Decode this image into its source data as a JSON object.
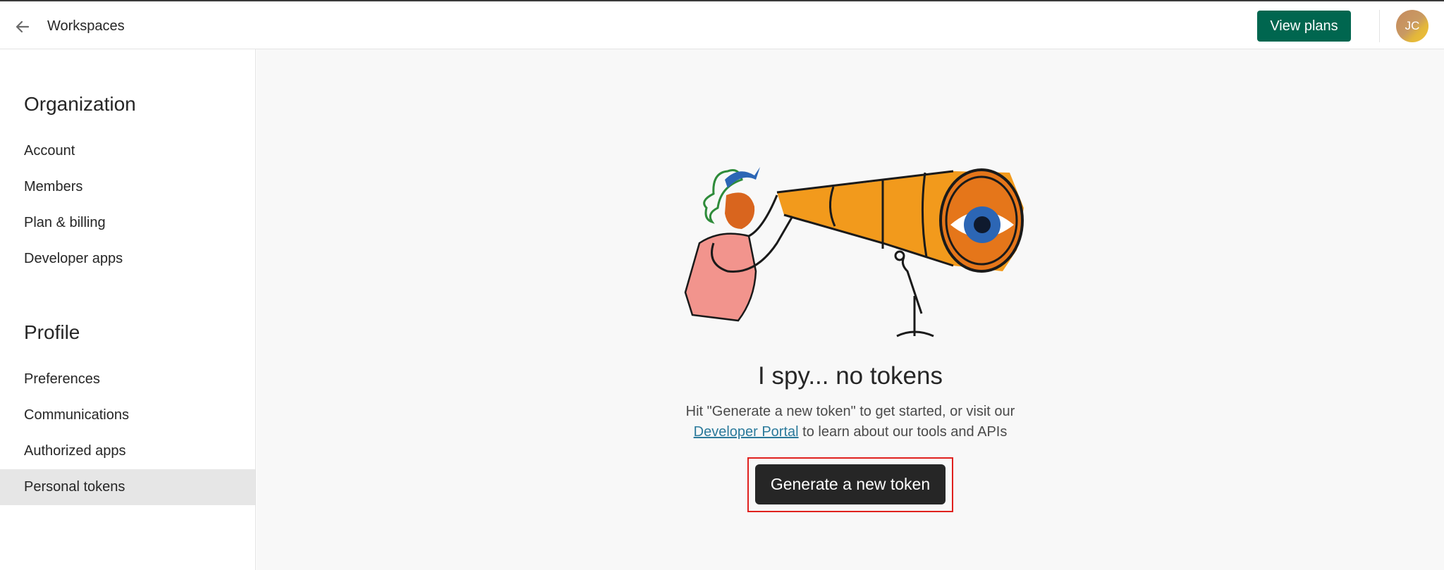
{
  "topbar": {
    "back_icon": "arrow-left-icon",
    "title": "Workspaces",
    "view_plans_label": "View plans",
    "avatar_initials": "JC"
  },
  "sidebar": {
    "organization": {
      "heading": "Organization",
      "items": [
        {
          "label": "Account"
        },
        {
          "label": "Members"
        },
        {
          "label": "Plan & billing"
        },
        {
          "label": "Developer apps"
        }
      ]
    },
    "profile": {
      "heading": "Profile",
      "items": [
        {
          "label": "Preferences"
        },
        {
          "label": "Communications"
        },
        {
          "label": "Authorized apps"
        },
        {
          "label": "Personal tokens",
          "active": true
        }
      ]
    }
  },
  "main": {
    "illustration": "woman-with-telescope-illustration",
    "title": "I spy... no tokens",
    "desc_line1": "Hit \"Generate a new token\" to get started, or visit our",
    "desc_link": "Developer Portal",
    "desc_line2_rest": " to learn about our tools and APIs",
    "generate_label": "Generate a new token"
  },
  "colors": {
    "primary_green": "#00664f",
    "dark_button": "#262626",
    "link": "#2b7a9b",
    "highlight_red": "#e0211e",
    "active_nav_bg": "#e6e6e6"
  }
}
